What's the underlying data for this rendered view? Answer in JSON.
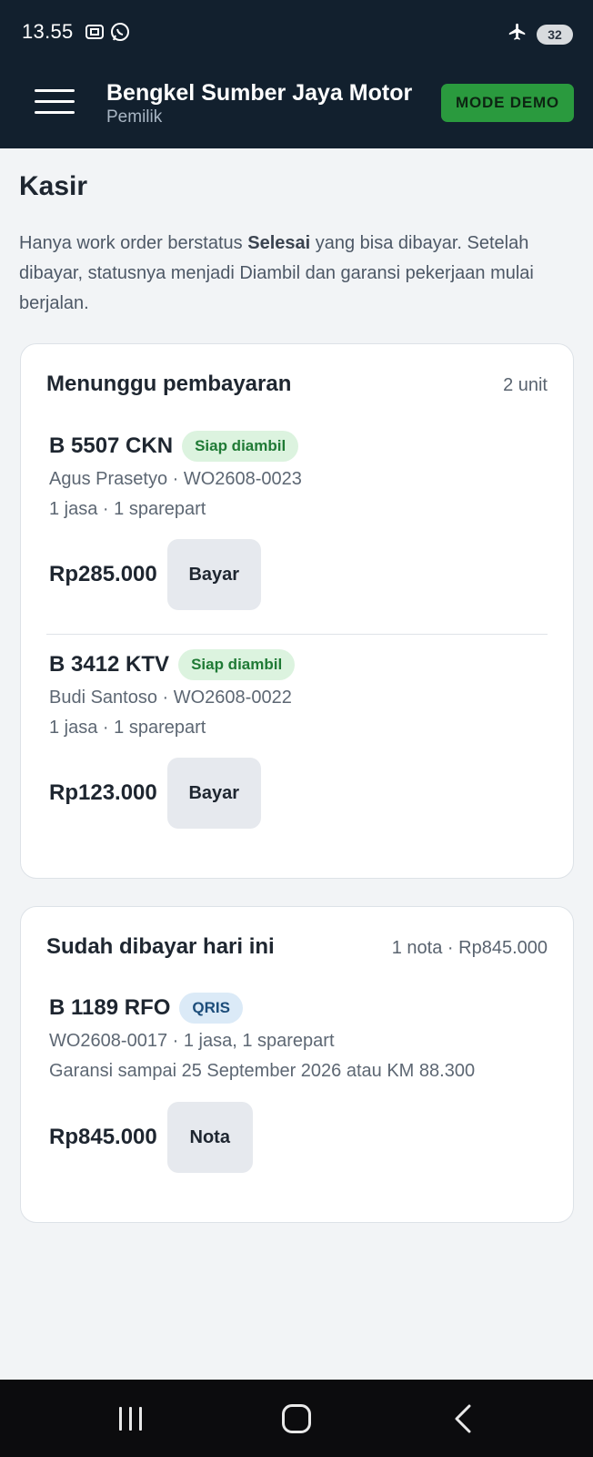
{
  "status_bar": {
    "time": "13.55",
    "battery": "32",
    "icons": [
      "screenshot-icon",
      "whatsapp-icon",
      "airplane-icon",
      "battery-icon"
    ]
  },
  "header": {
    "title": "Bengkel Sumber Jaya Motor",
    "subtitle": "Pemilik",
    "demo_button": "MODE DEMO"
  },
  "page": {
    "title": "Kasir",
    "intro_before": "Hanya work order berstatus ",
    "intro_bold": "Selesai",
    "intro_after": " yang bisa dibayar. Setelah dibayar, statusnya menjadi Diambil dan garansi pekerjaan mulai berjalan."
  },
  "pending": {
    "title": "Menunggu pembayaran",
    "meta": "2 unit",
    "items": [
      {
        "plate": "B 5507 CKN",
        "badge": "Siap diambil",
        "line1": "Agus Prasetyo · WO2608-0023",
        "line2": "1 jasa · 1 sparepart",
        "price": "Rp285.000",
        "action": "Bayar"
      },
      {
        "plate": "B 3412 KTV",
        "badge": "Siap diambil",
        "line1": "Budi Santoso · WO2608-0022",
        "line2": "1 jasa · 1 sparepart",
        "price": "Rp123.000",
        "action": "Bayar"
      }
    ]
  },
  "paid": {
    "title": "Sudah dibayar hari ini",
    "meta": "1 nota · Rp845.000",
    "items": [
      {
        "plate": "B 1189 RFO",
        "badge": "QRIS",
        "line1": "WO2608-0017 · 1 jasa, 1 sparepart",
        "line2": "Garansi sampai 25 September 2026 atau KM 88.300",
        "price": "Rp845.000",
        "action": "Nota"
      }
    ]
  },
  "colors": {
    "header_bg": "#12202e",
    "demo_button_bg": "#2a9a3e",
    "badge_green_bg": "#dcf3df",
    "badge_green_text": "#1f7a35",
    "badge_blue_bg": "#dbeaf7",
    "badge_blue_text": "#1c4d7a",
    "page_bg": "#f2f4f6"
  }
}
